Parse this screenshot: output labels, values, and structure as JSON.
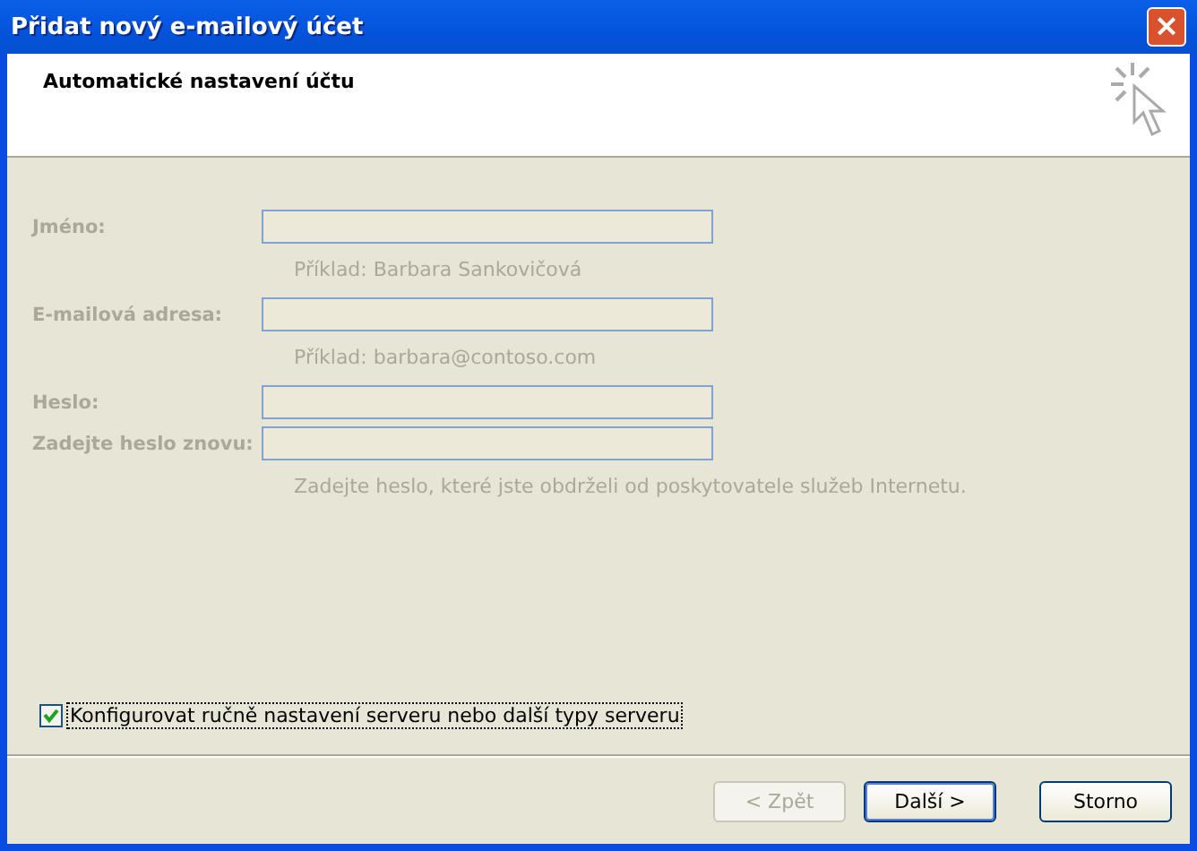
{
  "window": {
    "title": "Přidat nový e-mailový účet",
    "close": "×"
  },
  "header": {
    "title": "Automatické nastavení účtu"
  },
  "fields": [
    {
      "label": "Jméno:",
      "hint": "Příklad: Barbara Sankovičová",
      "disabled": true
    },
    {
      "label": "E-mailová adresa:",
      "hint": "Příklad: barbara@contoso.com",
      "disabled": true
    },
    {
      "label": "Heslo:",
      "disabled": true
    },
    {
      "label": "Zadejte heslo znovu:",
      "hint": "Zadejte heslo, které jste obdrželi od poskytovatele služeb Internetu.",
      "disabled": true
    }
  ],
  "manual": {
    "label": "Konfigurovat ručně nastavení serveru nebo další typy serveru",
    "checked": true
  },
  "buttons": [
    {
      "label": "< Zpět",
      "disabled": true,
      "default": false
    },
    {
      "label": "Další >",
      "disabled": false,
      "default": true
    },
    {
      "label": "Storno",
      "disabled": false,
      "default": false
    }
  ]
}
